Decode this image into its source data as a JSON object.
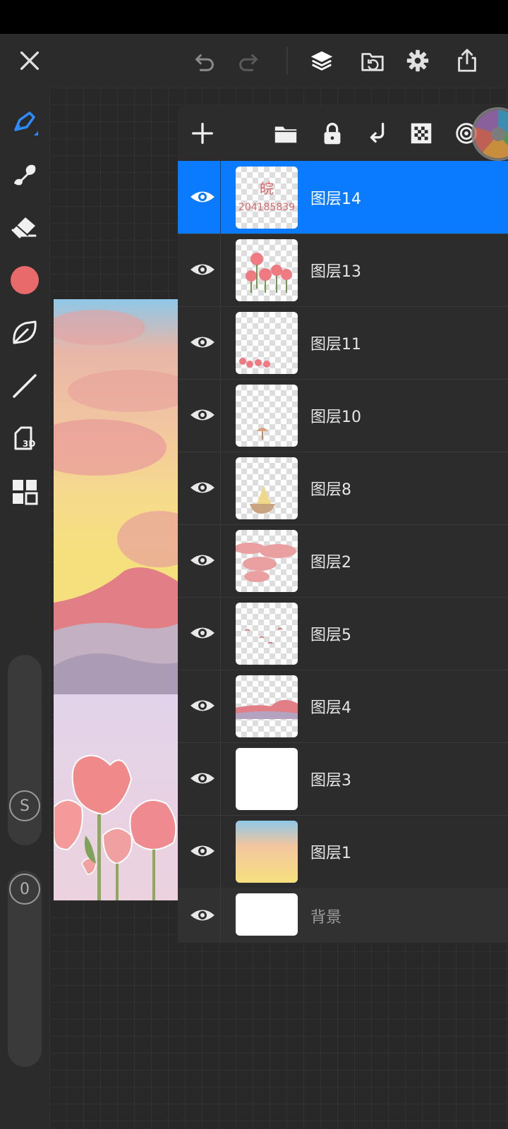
{
  "app": {
    "accent_color": "#0a7aff",
    "current_brush_color": "#e86a6a"
  },
  "topbar": {
    "icons": [
      "close-icon",
      "undo-icon",
      "redo-icon",
      "layers-icon",
      "import-folder-icon",
      "settings-icon",
      "share-icon"
    ]
  },
  "left_toolbar": {
    "tools": [
      "brush-tool-icon",
      "smudge-tool-icon",
      "eraser-tool-icon",
      "color-swatch",
      "shape-tool-icon",
      "line-tool-icon",
      "3d-tool-icon",
      "gallery-tool-icon"
    ],
    "size_slider_label": "S",
    "opacity_slider_label": "0"
  },
  "layers_panel": {
    "header_icons": [
      "add-layer-icon",
      "group-folder-icon",
      "lock-icon",
      "merge-down-icon",
      "transparency-icon",
      "blend-icon"
    ],
    "layers": [
      {
        "name": "图层14",
        "selected": true,
        "visible": true,
        "thumb_text": "皖",
        "thumb_text2": "204185839"
      },
      {
        "name": "图层13",
        "selected": false,
        "visible": true
      },
      {
        "name": "图层11",
        "selected": false,
        "visible": true
      },
      {
        "name": "图层10",
        "selected": false,
        "visible": true
      },
      {
        "name": "图层8",
        "selected": false,
        "visible": true
      },
      {
        "name": "图层2",
        "selected": false,
        "visible": true
      },
      {
        "name": "图层5",
        "selected": false,
        "visible": true
      },
      {
        "name": "图层4",
        "selected": false,
        "visible": true
      },
      {
        "name": "图层3",
        "selected": false,
        "visible": true
      },
      {
        "name": "图层1",
        "selected": false,
        "visible": true
      },
      {
        "name": "背景",
        "selected": false,
        "visible": true
      }
    ]
  }
}
